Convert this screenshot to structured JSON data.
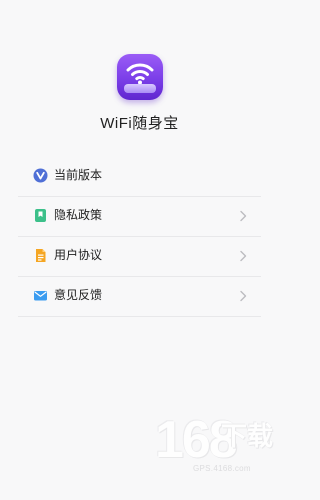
{
  "app": {
    "name": "WiFi随身宝",
    "icon": "wifi-icon",
    "accent_color": "#7b3ee8"
  },
  "menu": {
    "items": [
      {
        "label": "当前版本",
        "icon": "version-v-icon",
        "icon_color": "#4f6fd6",
        "has_chevron": false
      },
      {
        "label": "隐私政策",
        "icon": "bookmark-icon",
        "icon_color": "#3cc08a",
        "has_chevron": true
      },
      {
        "label": "用户协议",
        "icon": "document-icon",
        "icon_color": "#f5a623",
        "has_chevron": true
      },
      {
        "label": "意见反馈",
        "icon": "mail-icon",
        "icon_color": "#3b9cf0",
        "has_chevron": true
      }
    ]
  },
  "watermark": {
    "number": "168",
    "suffix": "下载",
    "url": "GPS.4168.com"
  }
}
